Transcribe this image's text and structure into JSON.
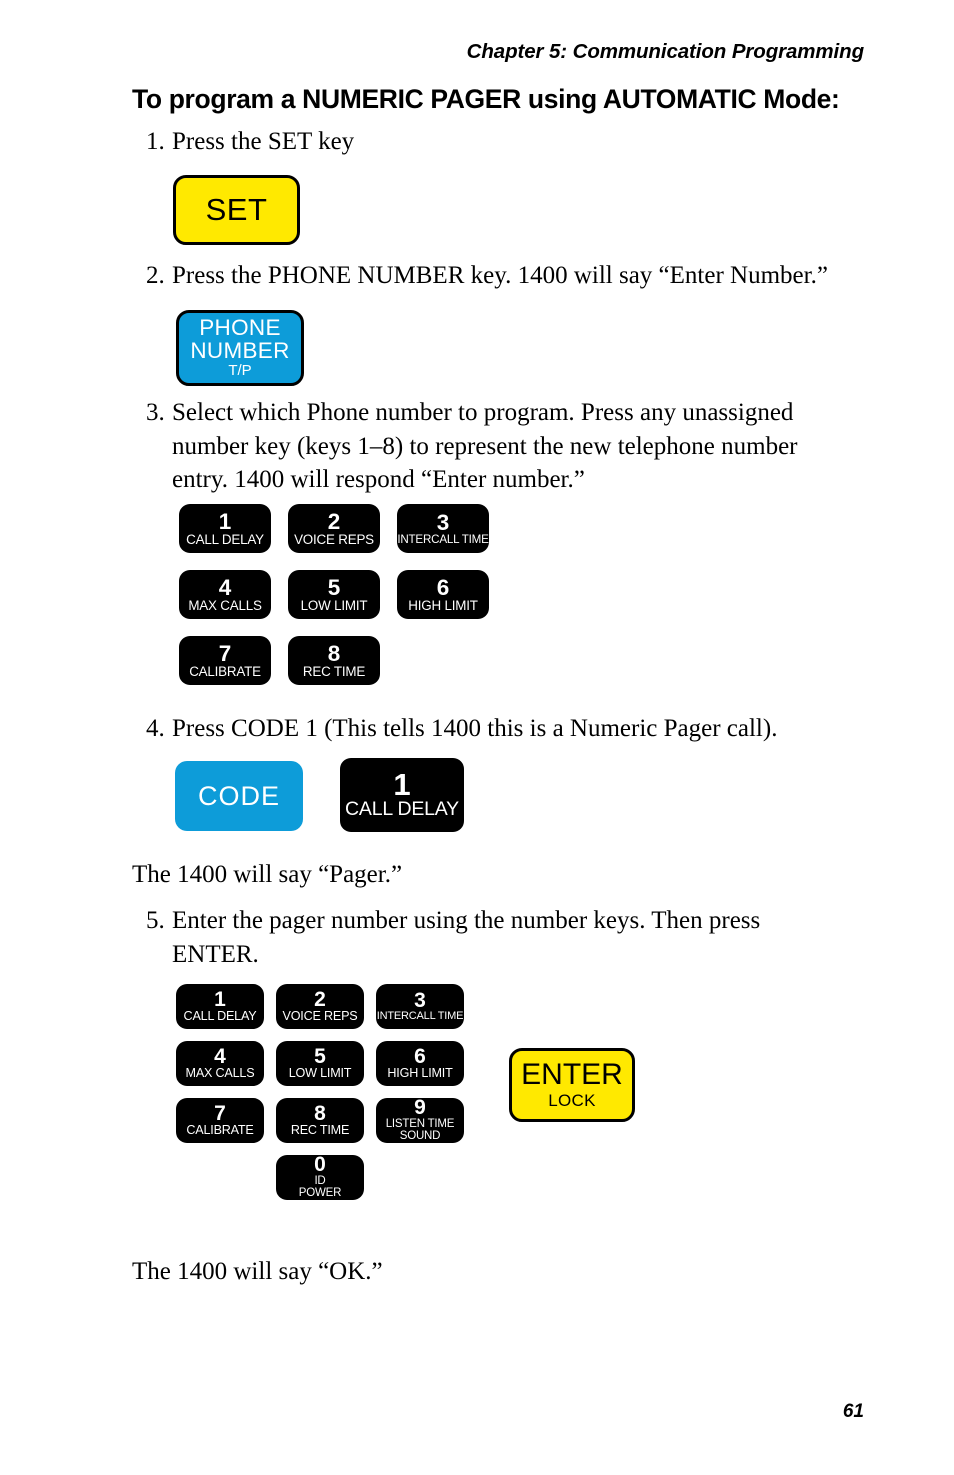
{
  "header": {
    "running_head": "Chapter 5: Communication Programming"
  },
  "page": {
    "number": "61"
  },
  "section": {
    "title": "To program a NUMERIC PAGER using AUTOMATIC Mode:"
  },
  "steps": {
    "s1": {
      "num": "1.",
      "text": "Press the SET key"
    },
    "s2": {
      "num": "2.",
      "text": "Press the PHONE NUMBER key. 1400 will say “Enter Number.”"
    },
    "s3": {
      "num": "3.",
      "text": "Select which Phone number to program. Press any unassigned number key (keys 1–8) to represent the new telephone number entry. 1400 will respond “Enter number.”"
    },
    "s4": {
      "num": "4.",
      "text": "Press CODE 1 (This tells 1400 this is a Numeric Pager call)."
    },
    "s5": {
      "num": "5.",
      "text": "Enter the pager number using the number keys. Then press ENTER."
    }
  },
  "notes": {
    "pager": "The 1400 will say “Pager.”",
    "ok": "The 1400 will say “OK.”"
  },
  "keys": {
    "set": {
      "label": "SET",
      "color": "#ffe900"
    },
    "phone_number": {
      "line1": "PHONE",
      "line2": "NUMBER",
      "line3": "T/P",
      "color": "#0d9cd9"
    },
    "code": {
      "label": "CODE",
      "color": "#0d9cd9"
    },
    "enter": {
      "line1": "ENTER",
      "line2": "LOCK",
      "color": "#ffe900"
    },
    "code_one": {
      "digit": "1",
      "label": "CALL DELAY",
      "color": "#000000"
    }
  },
  "keypad_a": {
    "rows": [
      [
        {
          "digit": "1",
          "label": "CALL DELAY"
        },
        {
          "digit": "2",
          "label": "VOICE REPS"
        },
        {
          "digit": "3",
          "label": "INTERCALL TIME"
        }
      ],
      [
        {
          "digit": "4",
          "label": "MAX CALLS"
        },
        {
          "digit": "5",
          "label": "LOW LIMIT"
        },
        {
          "digit": "6",
          "label": "HIGH LIMIT"
        }
      ],
      [
        {
          "digit": "7",
          "label": "CALIBRATE"
        },
        {
          "digit": "8",
          "label": "REC TIME"
        }
      ]
    ]
  },
  "keypad_b": {
    "rows": [
      [
        {
          "digit": "1",
          "label": "CALL DELAY"
        },
        {
          "digit": "2",
          "label": "VOICE REPS"
        },
        {
          "digit": "3",
          "label": "INTERCALL TIME"
        }
      ],
      [
        {
          "digit": "4",
          "label": "MAX CALLS"
        },
        {
          "digit": "5",
          "label": "LOW LIMIT"
        },
        {
          "digit": "6",
          "label": "HIGH LIMIT"
        }
      ],
      [
        {
          "digit": "7",
          "label": "CALIBRATE"
        },
        {
          "digit": "8",
          "label": "REC TIME"
        },
        {
          "digit": "9",
          "label_line1": "LISTEN TIME",
          "label_line2": "SOUND"
        }
      ],
      [
        {
          "digit": "0",
          "label_line1": "ID",
          "label_line2": "POWER"
        }
      ]
    ]
  }
}
